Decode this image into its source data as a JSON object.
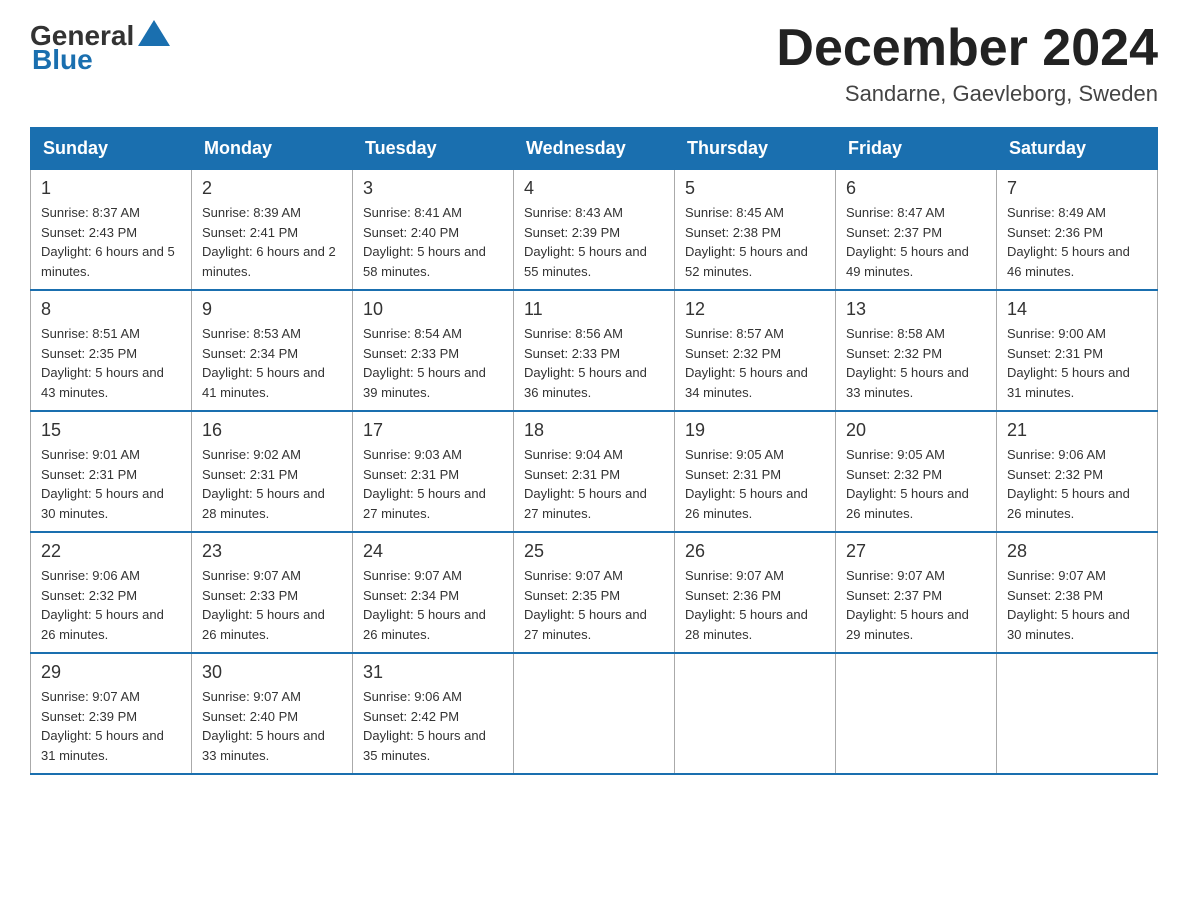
{
  "header": {
    "logo": {
      "general": "General",
      "blue": "Blue"
    },
    "month_title": "December 2024",
    "location": "Sandarne, Gaevleborg, Sweden"
  },
  "days_of_week": [
    "Sunday",
    "Monday",
    "Tuesday",
    "Wednesday",
    "Thursday",
    "Friday",
    "Saturday"
  ],
  "weeks": [
    [
      {
        "day": "1",
        "sunrise": "8:37 AM",
        "sunset": "2:43 PM",
        "daylight": "6 hours and 5 minutes."
      },
      {
        "day": "2",
        "sunrise": "8:39 AM",
        "sunset": "2:41 PM",
        "daylight": "6 hours and 2 minutes."
      },
      {
        "day": "3",
        "sunrise": "8:41 AM",
        "sunset": "2:40 PM",
        "daylight": "5 hours and 58 minutes."
      },
      {
        "day": "4",
        "sunrise": "8:43 AM",
        "sunset": "2:39 PM",
        "daylight": "5 hours and 55 minutes."
      },
      {
        "day": "5",
        "sunrise": "8:45 AM",
        "sunset": "2:38 PM",
        "daylight": "5 hours and 52 minutes."
      },
      {
        "day": "6",
        "sunrise": "8:47 AM",
        "sunset": "2:37 PM",
        "daylight": "5 hours and 49 minutes."
      },
      {
        "day": "7",
        "sunrise": "8:49 AM",
        "sunset": "2:36 PM",
        "daylight": "5 hours and 46 minutes."
      }
    ],
    [
      {
        "day": "8",
        "sunrise": "8:51 AM",
        "sunset": "2:35 PM",
        "daylight": "5 hours and 43 minutes."
      },
      {
        "day": "9",
        "sunrise": "8:53 AM",
        "sunset": "2:34 PM",
        "daylight": "5 hours and 41 minutes."
      },
      {
        "day": "10",
        "sunrise": "8:54 AM",
        "sunset": "2:33 PM",
        "daylight": "5 hours and 39 minutes."
      },
      {
        "day": "11",
        "sunrise": "8:56 AM",
        "sunset": "2:33 PM",
        "daylight": "5 hours and 36 minutes."
      },
      {
        "day": "12",
        "sunrise": "8:57 AM",
        "sunset": "2:32 PM",
        "daylight": "5 hours and 34 minutes."
      },
      {
        "day": "13",
        "sunrise": "8:58 AM",
        "sunset": "2:32 PM",
        "daylight": "5 hours and 33 minutes."
      },
      {
        "day": "14",
        "sunrise": "9:00 AM",
        "sunset": "2:31 PM",
        "daylight": "5 hours and 31 minutes."
      }
    ],
    [
      {
        "day": "15",
        "sunrise": "9:01 AM",
        "sunset": "2:31 PM",
        "daylight": "5 hours and 30 minutes."
      },
      {
        "day": "16",
        "sunrise": "9:02 AM",
        "sunset": "2:31 PM",
        "daylight": "5 hours and 28 minutes."
      },
      {
        "day": "17",
        "sunrise": "9:03 AM",
        "sunset": "2:31 PM",
        "daylight": "5 hours and 27 minutes."
      },
      {
        "day": "18",
        "sunrise": "9:04 AM",
        "sunset": "2:31 PM",
        "daylight": "5 hours and 27 minutes."
      },
      {
        "day": "19",
        "sunrise": "9:05 AM",
        "sunset": "2:31 PM",
        "daylight": "5 hours and 26 minutes."
      },
      {
        "day": "20",
        "sunrise": "9:05 AM",
        "sunset": "2:32 PM",
        "daylight": "5 hours and 26 minutes."
      },
      {
        "day": "21",
        "sunrise": "9:06 AM",
        "sunset": "2:32 PM",
        "daylight": "5 hours and 26 minutes."
      }
    ],
    [
      {
        "day": "22",
        "sunrise": "9:06 AM",
        "sunset": "2:32 PM",
        "daylight": "5 hours and 26 minutes."
      },
      {
        "day": "23",
        "sunrise": "9:07 AM",
        "sunset": "2:33 PM",
        "daylight": "5 hours and 26 minutes."
      },
      {
        "day": "24",
        "sunrise": "9:07 AM",
        "sunset": "2:34 PM",
        "daylight": "5 hours and 26 minutes."
      },
      {
        "day": "25",
        "sunrise": "9:07 AM",
        "sunset": "2:35 PM",
        "daylight": "5 hours and 27 minutes."
      },
      {
        "day": "26",
        "sunrise": "9:07 AM",
        "sunset": "2:36 PM",
        "daylight": "5 hours and 28 minutes."
      },
      {
        "day": "27",
        "sunrise": "9:07 AM",
        "sunset": "2:37 PM",
        "daylight": "5 hours and 29 minutes."
      },
      {
        "day": "28",
        "sunrise": "9:07 AM",
        "sunset": "2:38 PM",
        "daylight": "5 hours and 30 minutes."
      }
    ],
    [
      {
        "day": "29",
        "sunrise": "9:07 AM",
        "sunset": "2:39 PM",
        "daylight": "5 hours and 31 minutes."
      },
      {
        "day": "30",
        "sunrise": "9:07 AM",
        "sunset": "2:40 PM",
        "daylight": "5 hours and 33 minutes."
      },
      {
        "day": "31",
        "sunrise": "9:06 AM",
        "sunset": "2:42 PM",
        "daylight": "5 hours and 35 minutes."
      },
      null,
      null,
      null,
      null
    ]
  ],
  "labels": {
    "sunrise_prefix": "Sunrise: ",
    "sunset_prefix": "Sunset: ",
    "daylight_prefix": "Daylight: "
  }
}
